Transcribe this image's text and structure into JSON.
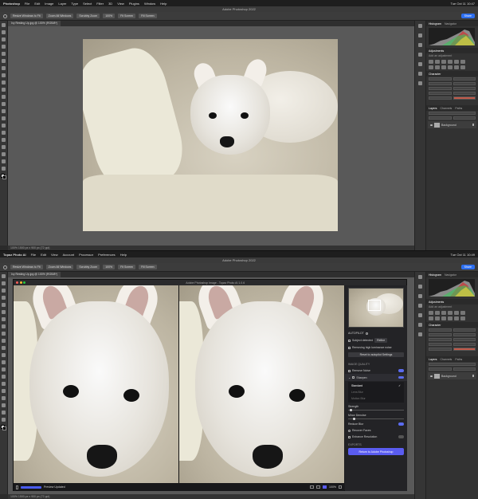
{
  "top": {
    "menubar": {
      "app": "Photoshop",
      "items": [
        "File",
        "Edit",
        "Image",
        "Layer",
        "Type",
        "Select",
        "Filter",
        "3D",
        "View",
        "Plugins",
        "Window",
        "Help"
      ],
      "clock": "Tue Oct 11 10:47"
    },
    "title": "Adobe Photoshop 2022",
    "options": {
      "chips": [
        "Resize Windows to Fit",
        "Zoom All Windows",
        "Scrubby Zoom",
        "100%",
        "Fit Screen",
        "Fill Screen"
      ],
      "share": "Share"
    },
    "doc_tab": "Ivy Resting Up.jpg @ 100% (RGB/8*)",
    "status": "100%   1500 px x 900 px (72 ppi)",
    "panels": {
      "tabs": [
        "Histogram",
        "Navigator"
      ],
      "adjustments": "Adjustments",
      "add_adj": "Add an adjustment",
      "character": "Character",
      "layers_tabs": [
        "Layers",
        "Channels",
        "Paths"
      ],
      "layer_name": "Background"
    }
  },
  "bottom": {
    "menubar": {
      "app": "Topaz Photo AI",
      "items": [
        "File",
        "Edit",
        "View",
        "Account",
        "Processor",
        "Preferences",
        "Help"
      ],
      "clock": "Tue Oct 11 10:49"
    },
    "title": "Adobe Photoshop 2022",
    "options": {
      "chips": [
        "Resize Windows to Fit",
        "Zoom All Windows",
        "Scrubby Zoom",
        "100%",
        "Fit Screen",
        "Fill Screen"
      ],
      "share": "Share"
    },
    "doc_tab": "Ivy Resting Up.jpg @ 100% (RGB/8*)",
    "status": "100%   1500 px x 900 px (72 ppi)",
    "topaz": {
      "title": "Adobe Photoshop Image - Topaz Photo AI 1.0.6",
      "autopilot": "AUTOPILOT",
      "subject": "Subject detected",
      "refine": "Refine",
      "removing": "Removing high luminance noise",
      "reset": "Reset to autopilot Settings",
      "image_quality": "IMAGE QUALITY",
      "remove_noise": "Remove Noise",
      "sharpen": "Sharpen",
      "options": [
        "Standard",
        "Lens Blur",
        "Motion Blur"
      ],
      "strength": "Strength",
      "minor_denoise": "Minor Denoise",
      "reduce_blur": "Reduce Blur",
      "recover_faces": "Recover Faces",
      "enhance_resolution": "Enhance Resolution",
      "export_label": "Return to Adobe Photoshop",
      "preview": "Preview Updated",
      "zoom": "100%",
      "autopilot_section": "AUTOPILOT",
      "export_section": "EXPORTS"
    },
    "panels": {
      "tabs": [
        "Histogram",
        "Navigator"
      ],
      "adjustments": "Adjustments",
      "add_adj": "Add an adjustment",
      "character": "Character",
      "layers_tabs": [
        "Layers",
        "Channels",
        "Paths"
      ],
      "layer_name": "Background"
    }
  }
}
